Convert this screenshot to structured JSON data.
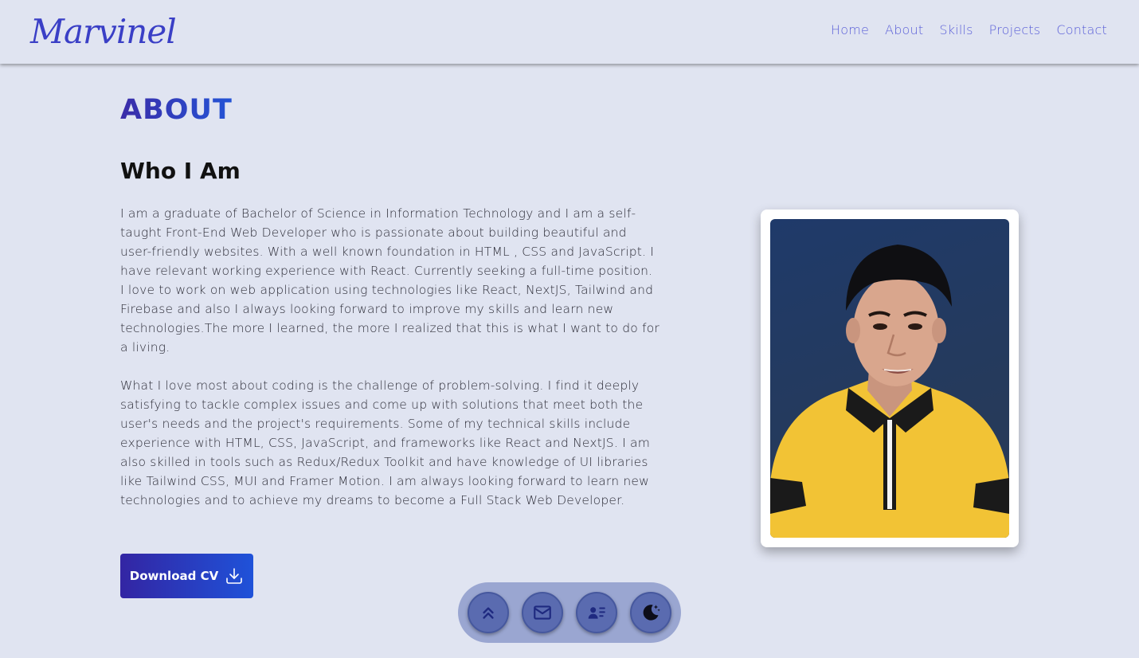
{
  "navbar": {
    "logo": "Marvinel",
    "links": [
      {
        "label": "Home"
      },
      {
        "label": "About"
      },
      {
        "label": "Skills"
      },
      {
        "label": "Projects"
      },
      {
        "label": "Contact"
      }
    ]
  },
  "about": {
    "section_title": "ABOUT",
    "subtitle": "Who I Am",
    "paragraph1": "I am a graduate of Bachelor of Science in Information Technology and I am a self-taught Front-End Web Developer who is passionate about building beautiful and user-friendly websites. With a well known foundation in HTML , CSS and JavaScript. I have relevant working experience with React. Currently seeking a full-time position. I love to work on web application using technologies like React, NextJS, Tailwind and Firebase and also I always looking forward to improve my skills and learn new technologies.The more I learned, the more I realized that this is what I want to do for a living.",
    "paragraph2": "What I love most about coding is the challenge of problem-solving. I find it deeply satisfying to tackle complex issues and come up with solutions that meet both the user's needs and the project's requirements. Some of my technical skills include experience with HTML, CSS, JavaScript, and frameworks like React and NextJS. I am also skilled in tools such as Redux/Redux Toolkit and have knowledge of UI libraries like Tailwind CSS, MUI and Framer Motion. I am always looking forward to learn new technologies and to achieve my dreams to become a Full Stack Web Developer.",
    "cv_button_label": "Download CV",
    "cv_button_icon": "download-icon"
  },
  "dock": {
    "buttons": [
      {
        "icon": "chevrons-up-icon"
      },
      {
        "icon": "mail-icon"
      },
      {
        "icon": "contact-card-icon"
      },
      {
        "icon": "moon-stars-icon"
      }
    ]
  },
  "colors": {
    "background": "#e0e4f1",
    "accent": "#3b3bbf",
    "nav_link": "#5a5fd8",
    "button_gradient_start": "#3325a3",
    "button_gradient_end": "#1f52d9",
    "dock_bg": "#9aa6d1",
    "dock_button": "#5a6bb0"
  }
}
